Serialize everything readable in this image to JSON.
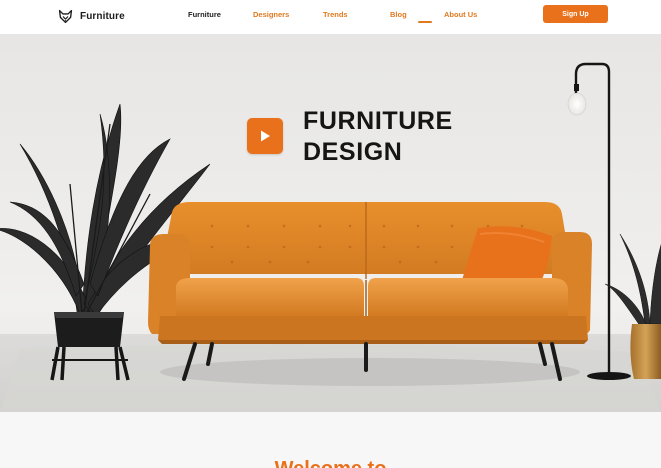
{
  "brand": {
    "name": "Furniture",
    "logo_icon": "fox-icon"
  },
  "nav": {
    "items": [
      {
        "label": "Furniture",
        "active": true
      },
      {
        "label": "Designers",
        "active": false
      },
      {
        "label": "Trends",
        "active": false
      },
      {
        "label": "Blog",
        "active": false
      },
      {
        "label": "About Us",
        "active": false
      }
    ],
    "signup_label": "Sign Up"
  },
  "hero": {
    "title_line1": "FURNITURE",
    "title_line2": "DESIGN",
    "play_icon": "play-icon"
  },
  "section": {
    "heading": "Welcome to"
  },
  "colors": {
    "accent": "#e9711c",
    "text_dark": "#151515",
    "sofa": "#e08a2e",
    "background": "#eeedeb"
  }
}
